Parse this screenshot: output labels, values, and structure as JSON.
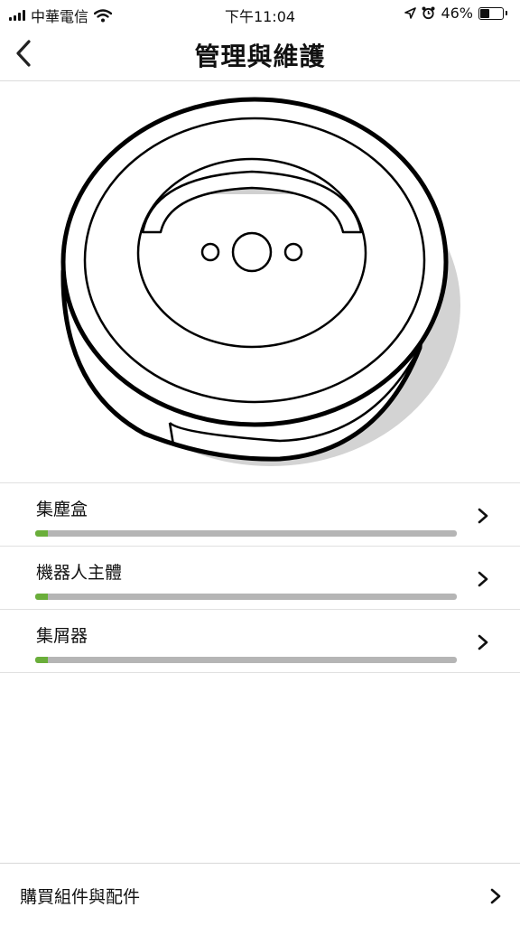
{
  "status_bar": {
    "carrier": "中華電信",
    "time": "下午11:04",
    "battery_percent": "46%",
    "battery_level": 0.46,
    "icons": [
      "signal-icon",
      "wifi-icon",
      "location-icon",
      "alarm-icon",
      "battery-icon"
    ]
  },
  "nav": {
    "title": "管理與維護",
    "back_icon": "chevron-left-icon"
  },
  "illustration": "robot-vacuum",
  "maintenance_items": [
    {
      "label": "集塵盒",
      "progress": 0.03,
      "icon": "chevron-right-icon"
    },
    {
      "label": "機器人主體",
      "progress": 0.03,
      "icon": "chevron-right-icon"
    },
    {
      "label": "集屑器",
      "progress": 0.03,
      "icon": "chevron-right-icon"
    }
  ],
  "footer": {
    "label": "購買組件與配件",
    "icon": "chevron-right-icon"
  },
  "colors": {
    "progress_fill": "#6aae3a",
    "progress_track": "#b5b5b5",
    "divider": "#e0e0e0"
  }
}
